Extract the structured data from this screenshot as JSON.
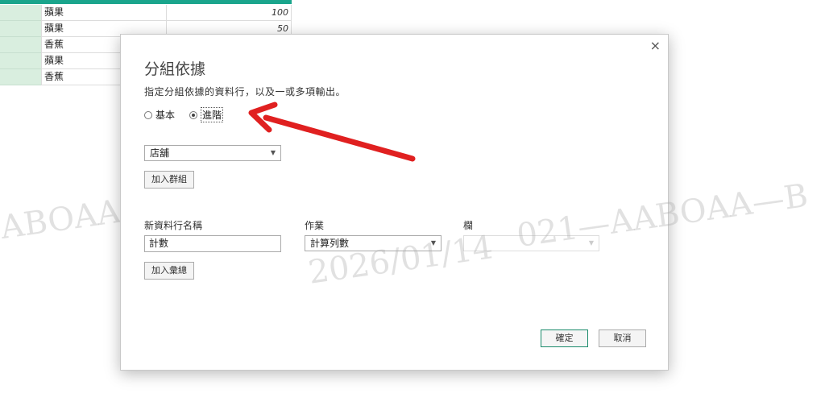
{
  "sheet": {
    "rows": [
      {
        "name": "蘋果",
        "value": "100"
      },
      {
        "name": "蘋果",
        "value": "50"
      },
      {
        "name": "香蕉",
        "value": ""
      },
      {
        "name": "蘋果",
        "value": ""
      },
      {
        "name": "香蕉",
        "value": ""
      }
    ]
  },
  "watermark": {
    "left_text": "ABOAA—B",
    "right_text": "021—AABOAA—B",
    "date_text": "2026/01/14"
  },
  "dialog": {
    "title": "分組依據",
    "description": "指定分組依據的資料行，以及一或多項輸出。",
    "close_icon": "×",
    "radio_basic": "基本",
    "radio_advanced": "進階",
    "group_by_value": "店舖",
    "add_group_button": "加入群組",
    "new_column_label": "新資料行名稱",
    "operation_label": "作業",
    "column_label": "欄",
    "new_column_value": "計數",
    "operation_value": "計算列數",
    "column_value": "",
    "add_aggregation_button": "加入彙總",
    "ok_button": "確定",
    "cancel_button": "取消"
  },
  "colors": {
    "annotation_arrow": "#e02020",
    "sheet_header": "#1aa58c"
  }
}
